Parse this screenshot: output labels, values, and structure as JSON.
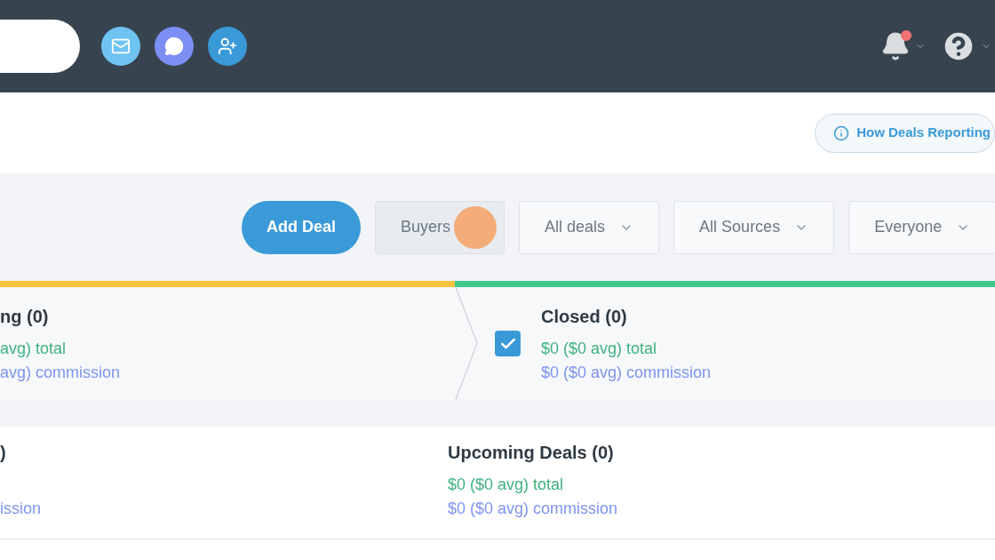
{
  "header": {
    "notifications": {
      "unread": true
    }
  },
  "info_button": {
    "label": "How Deals Reporting"
  },
  "toolbar": {
    "add_button": "Add Deal",
    "filters": [
      {
        "label": "Buyers",
        "highlighted": true
      },
      {
        "label": "All deals",
        "highlighted": false
      },
      {
        "label": "All Sources",
        "highlighted": false
      },
      {
        "label": "Everyone",
        "highlighted": false
      }
    ]
  },
  "stages": [
    {
      "title": "ng (0)",
      "total": "avg) total",
      "commission": "avg) commission",
      "color": "#f9c23c",
      "kind": "plain"
    },
    {
      "title": "Closed (0)",
      "total": "$0 ($0 avg) total",
      "commission": "$0 ($0 avg) commission",
      "color": "#3ec98e",
      "kind": "checkbox",
      "checked": true
    }
  ],
  "summary": [
    {
      "title": ")",
      "commission": "ission"
    },
    {
      "title": "Upcoming Deals (0)",
      "total": "$0 ($0 avg) total",
      "commission": "$0 ($0 avg) commission"
    }
  ]
}
